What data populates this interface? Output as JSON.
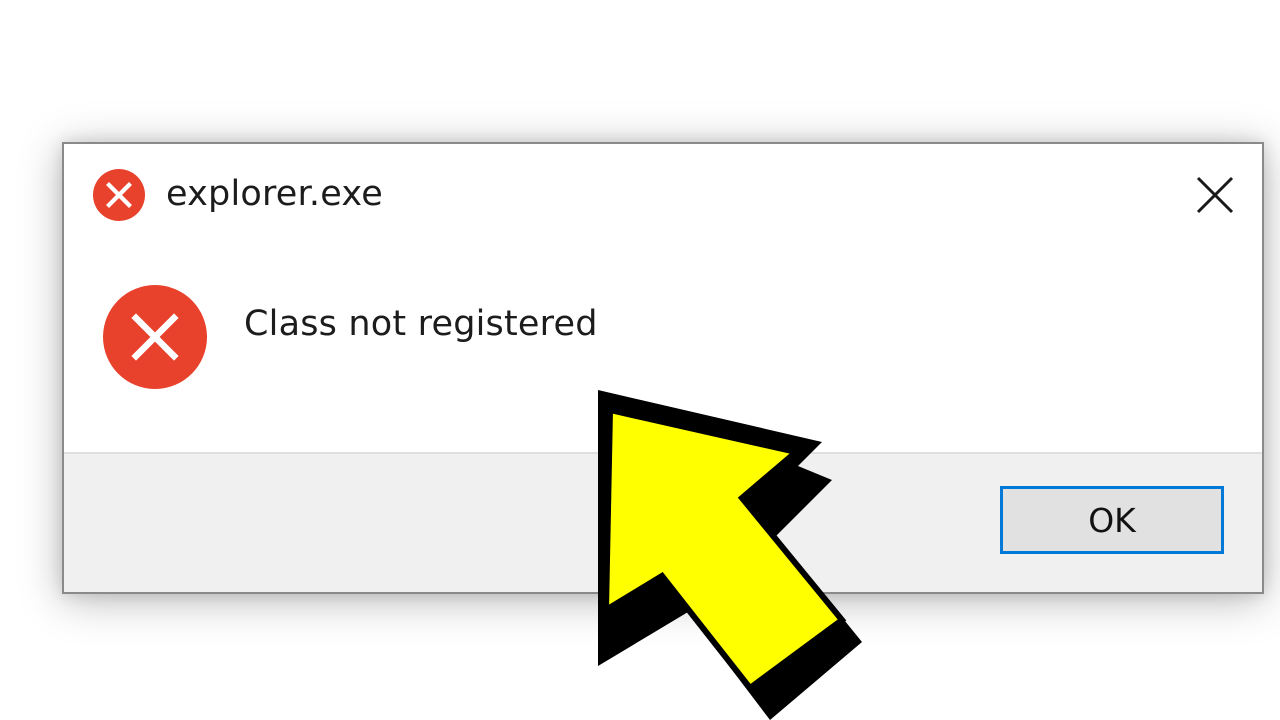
{
  "dialog": {
    "title": "explorer.exe",
    "message": "Class not registered",
    "ok_label": "OK"
  },
  "icons": {
    "title_icon": "error-icon",
    "message_icon": "error-icon",
    "close_icon": "close-icon",
    "arrow": "pointer-arrow-icon"
  },
  "colors": {
    "error_red": "#e8412c",
    "accent_blue": "#0078d7",
    "arrow_yellow": "#ffff00",
    "footer_bg": "#f0f0f0"
  }
}
